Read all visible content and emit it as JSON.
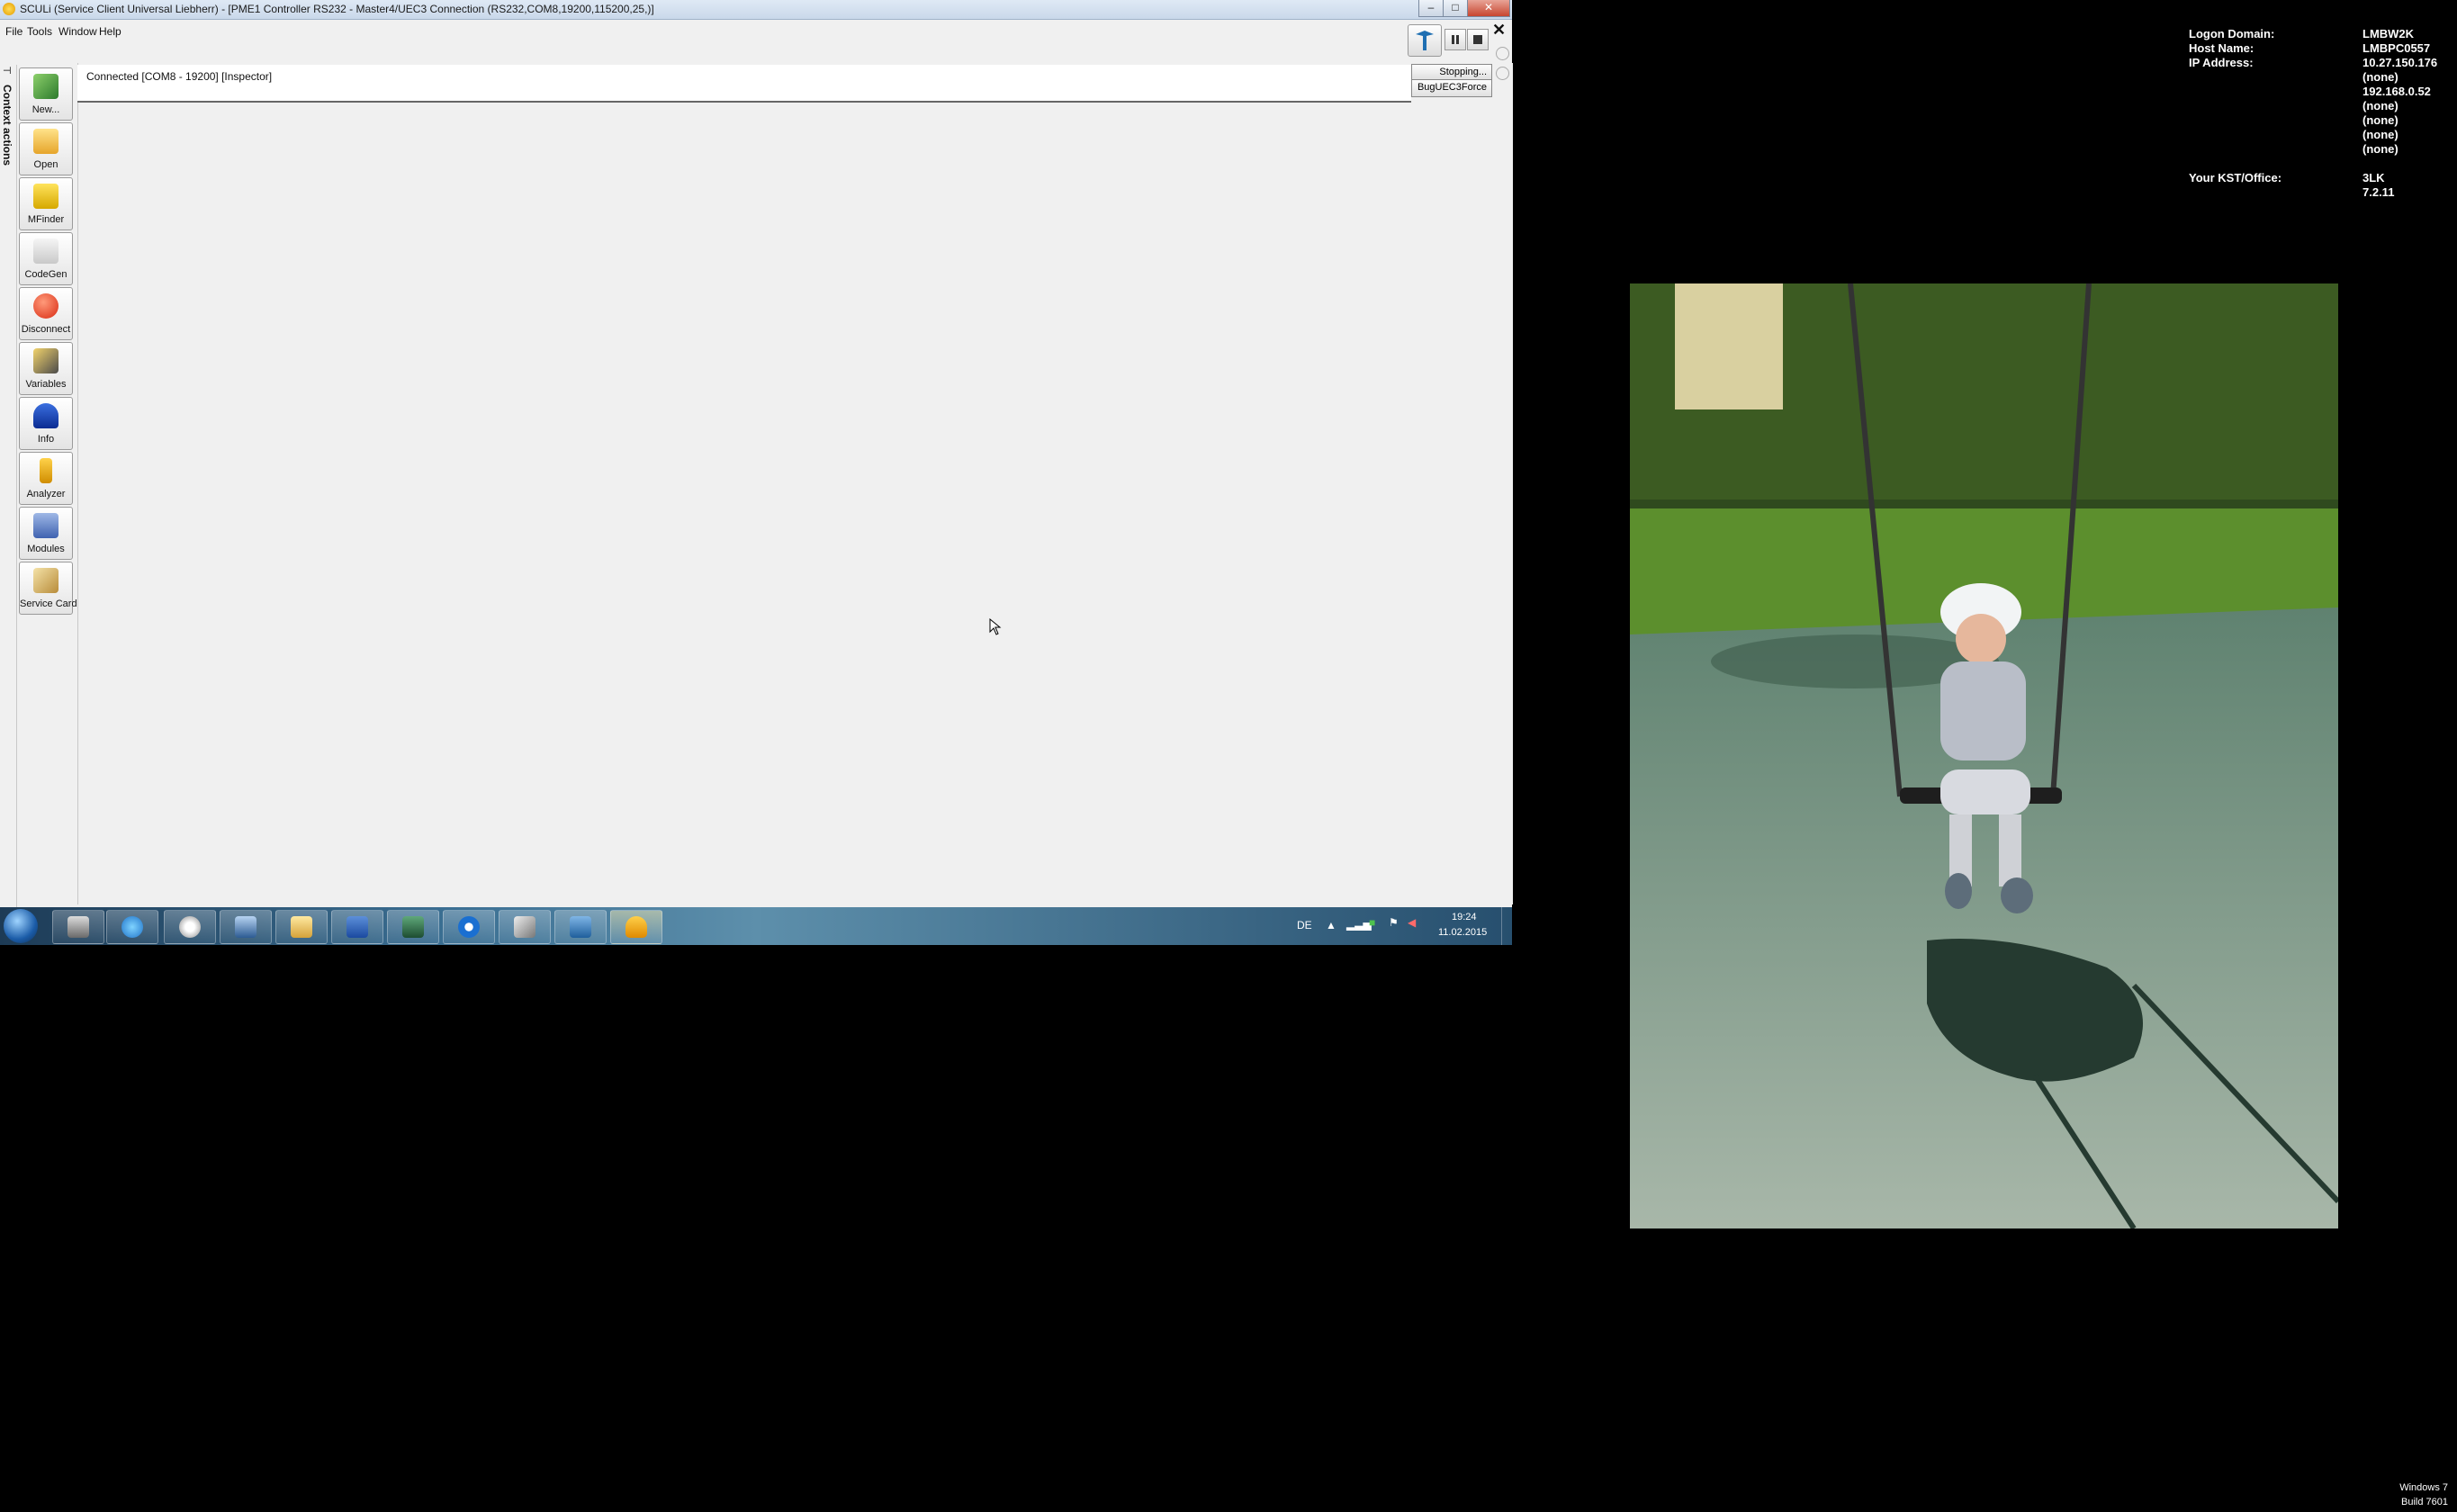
{
  "window": {
    "title": "SCULi (Service Client Universal Liebherr) - [PME1 Controller RS232 - Master4/UEC3 Connection (RS232,COM8,19200,115200,25,)]",
    "minimize": "–",
    "maximize": "□",
    "close": "✕",
    "inner_close": "✕"
  },
  "menu": [
    "File",
    "Tools",
    "Window",
    "Help"
  ],
  "context_tab": {
    "label": "Context actions",
    "pin": "⊣"
  },
  "sidebar": [
    {
      "label": "New...",
      "icon": "new-icon"
    },
    {
      "label": "Open",
      "icon": "open-folder-icon"
    },
    {
      "label": "MFinder",
      "icon": "mfinder-icon"
    },
    {
      "label": "CodeGen",
      "icon": "lock-icon"
    },
    {
      "label": "Disconnect",
      "icon": "disconnect-icon"
    },
    {
      "label": "Variables",
      "icon": "variables-icon"
    },
    {
      "label": "Info",
      "icon": "info-person-icon"
    },
    {
      "label": "Analyzer",
      "icon": "analyzer-icon"
    },
    {
      "label": "Modules",
      "icon": "modules-icon"
    },
    {
      "label": "Service Card",
      "icon": "service-card-icon"
    }
  ],
  "status": {
    "connection_text": "Connected [COM8 - 19200] [Inspector]",
    "stopping": "Stopping...",
    "bug_force": "BugUEC3Force"
  },
  "taskbar": {
    "apps": [
      "user-icon",
      "internet-explorer-icon",
      "settings-gear-icon",
      "network-computer-icon",
      "explorer-folder-icon",
      "word-icon",
      "terminal-icon",
      "teamviewer-icon",
      "pen-tool-icon",
      "sculi-icon",
      "helmet-icon"
    ],
    "language": "DE",
    "time": "19:24",
    "date": "11.02.2015"
  },
  "desktop_info": {
    "rows": [
      {
        "label": "Logon Domain:",
        "value": "LMBW2K"
      },
      {
        "label": "Host Name:",
        "value": "LMBPC0557"
      },
      {
        "label": "IP Address:",
        "value": "10.27.150.176"
      },
      {
        "label": "",
        "value": "(none)"
      },
      {
        "label": "",
        "value": "192.168.0.52"
      },
      {
        "label": "",
        "value": "(none)"
      },
      {
        "label": "",
        "value": "(none)"
      },
      {
        "label": "",
        "value": "(none)"
      },
      {
        "label": "",
        "value": "(none)"
      }
    ],
    "office_label": "Your KST/Office:",
    "office_values": [
      "3LK",
      "7.2.11"
    ]
  },
  "os_watermark": [
    "Windows 7",
    "Build 7601"
  ]
}
